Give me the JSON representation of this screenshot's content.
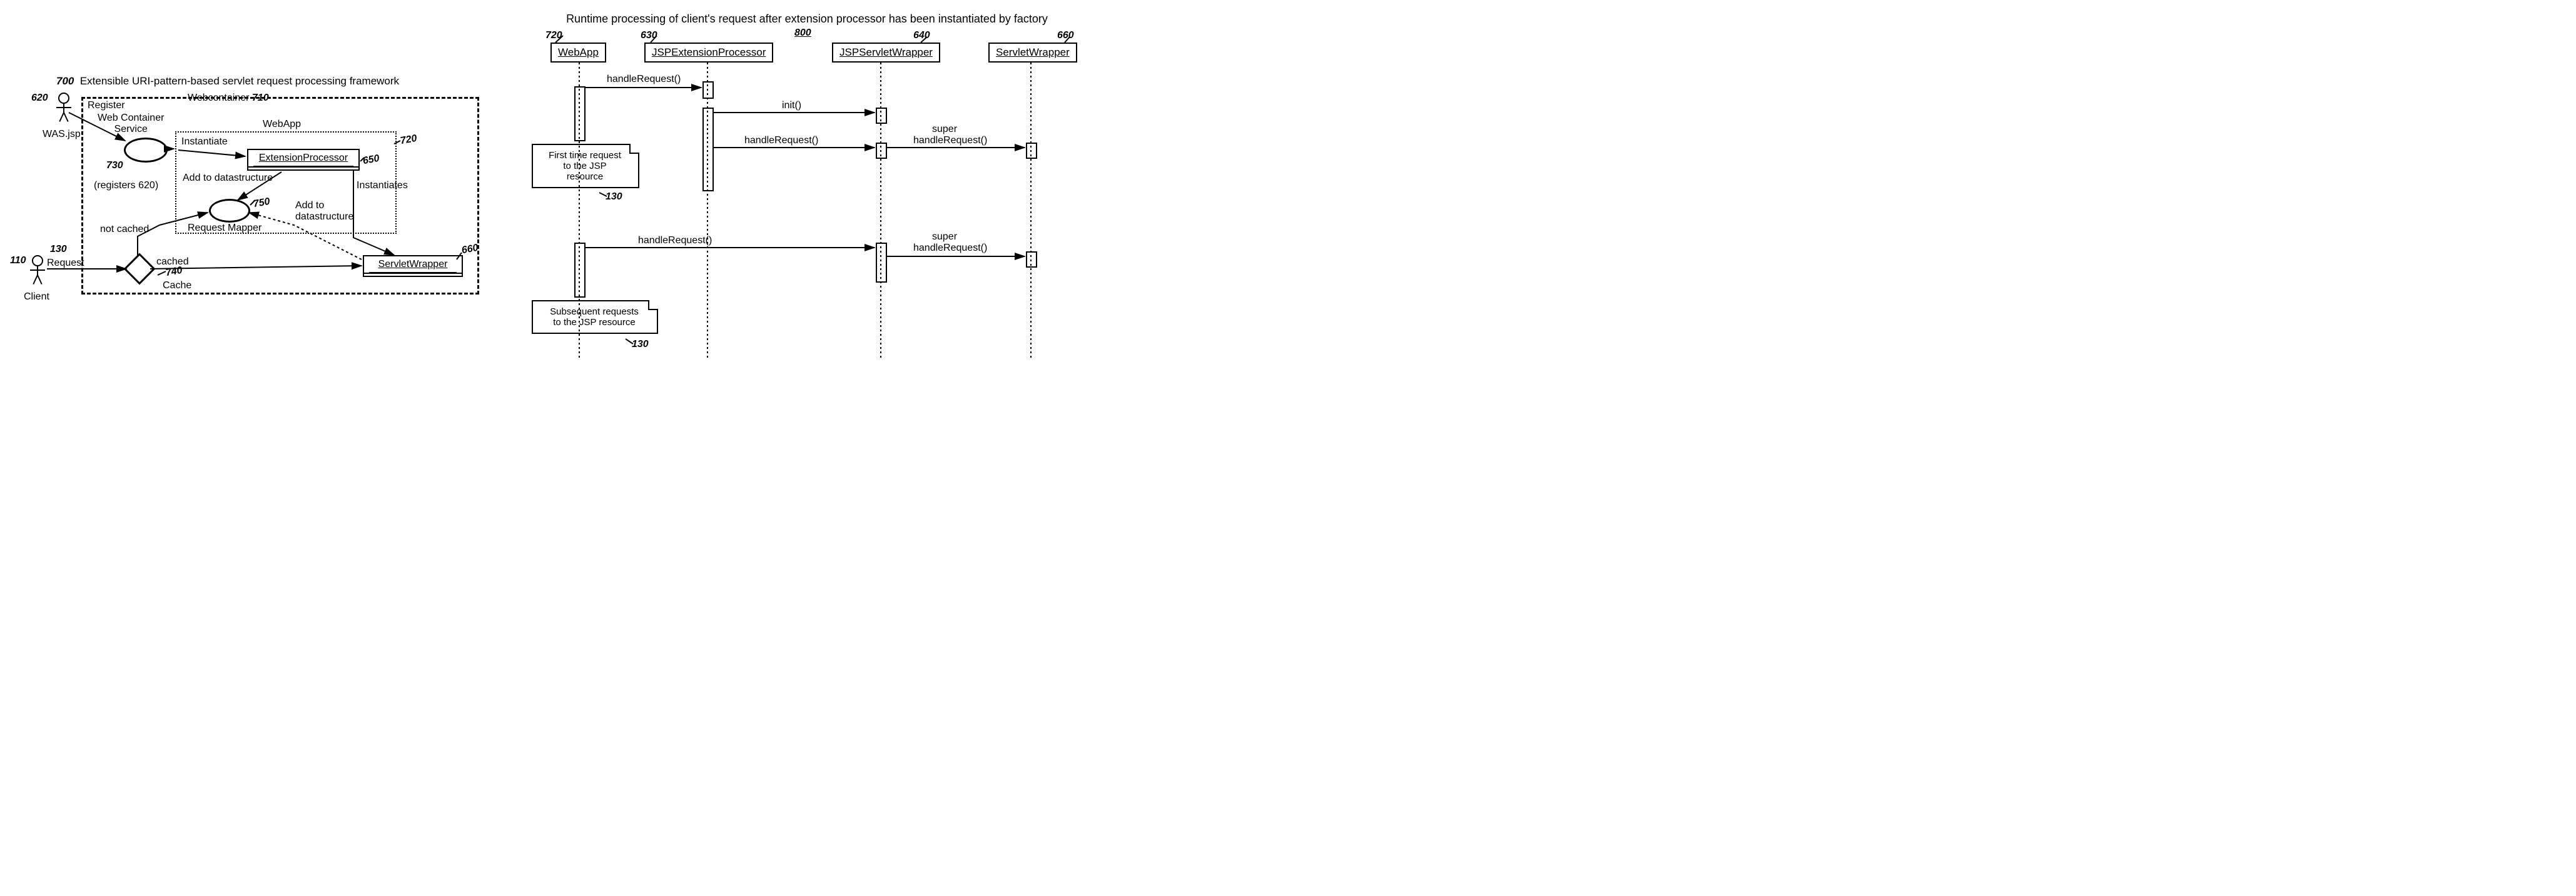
{
  "left": {
    "title_num": "700",
    "title_text": "Extensible URI-pattern-based servlet request processing framework",
    "actor_was": {
      "num": "620",
      "label": "WAS.jsp"
    },
    "actor_client": {
      "num": "110",
      "label": "Client",
      "req_num": "130",
      "req_text": "Request"
    },
    "register": "Register",
    "webcontainer": "Webcontainer",
    "webcontainer_num": "710",
    "wcs_label": "Web Container\nService",
    "wcs_num": "730",
    "registers_note": "(registers 620)",
    "webapp_label": "WebApp",
    "webapp_num": "720",
    "instantiate": "Instantiate",
    "extproc": "ExtensionProcessor",
    "extproc_num": "650",
    "add_ds1": "Add to datastructure",
    "instantiates": "Instantiates",
    "add_ds2": "Add to\ndatastructure",
    "reqmap_label": "Request Mapper",
    "reqmap_num": "750",
    "cache_label": "Cache",
    "cache_num": "740",
    "cached": "cached",
    "not_cached": "not cached",
    "servletwrapper": "ServletWrapper",
    "servletwrapper_num": "660"
  },
  "right": {
    "title": "Runtime processing of client's request after extension processor has been instantiated by factory",
    "num": "800",
    "lifelines": {
      "webapp": {
        "label": "WebApp",
        "num": "720"
      },
      "jspext": {
        "label": "JSPExtensionProcessor",
        "num": "630"
      },
      "jspsw": {
        "label": "JSPServletWrapper",
        "num": "640"
      },
      "sw": {
        "label": "ServletWrapper",
        "num": "660"
      }
    },
    "msg": {
      "handle1": "handleRequest()",
      "init": "init()",
      "handle2": "handleRequest()",
      "super1a": "super",
      "super1b": "handleRequest()",
      "handle3": "handleRequest()",
      "super2a": "super",
      "super2b": "handleRequest()"
    },
    "note1_line1": "First time request",
    "note1_line2": "to the JSP",
    "note1_line3": "resource",
    "note1_num": "130",
    "note2_line1": "Subsequent requests",
    "note2_line2": "to the JSP resource",
    "note2_num": "130"
  }
}
